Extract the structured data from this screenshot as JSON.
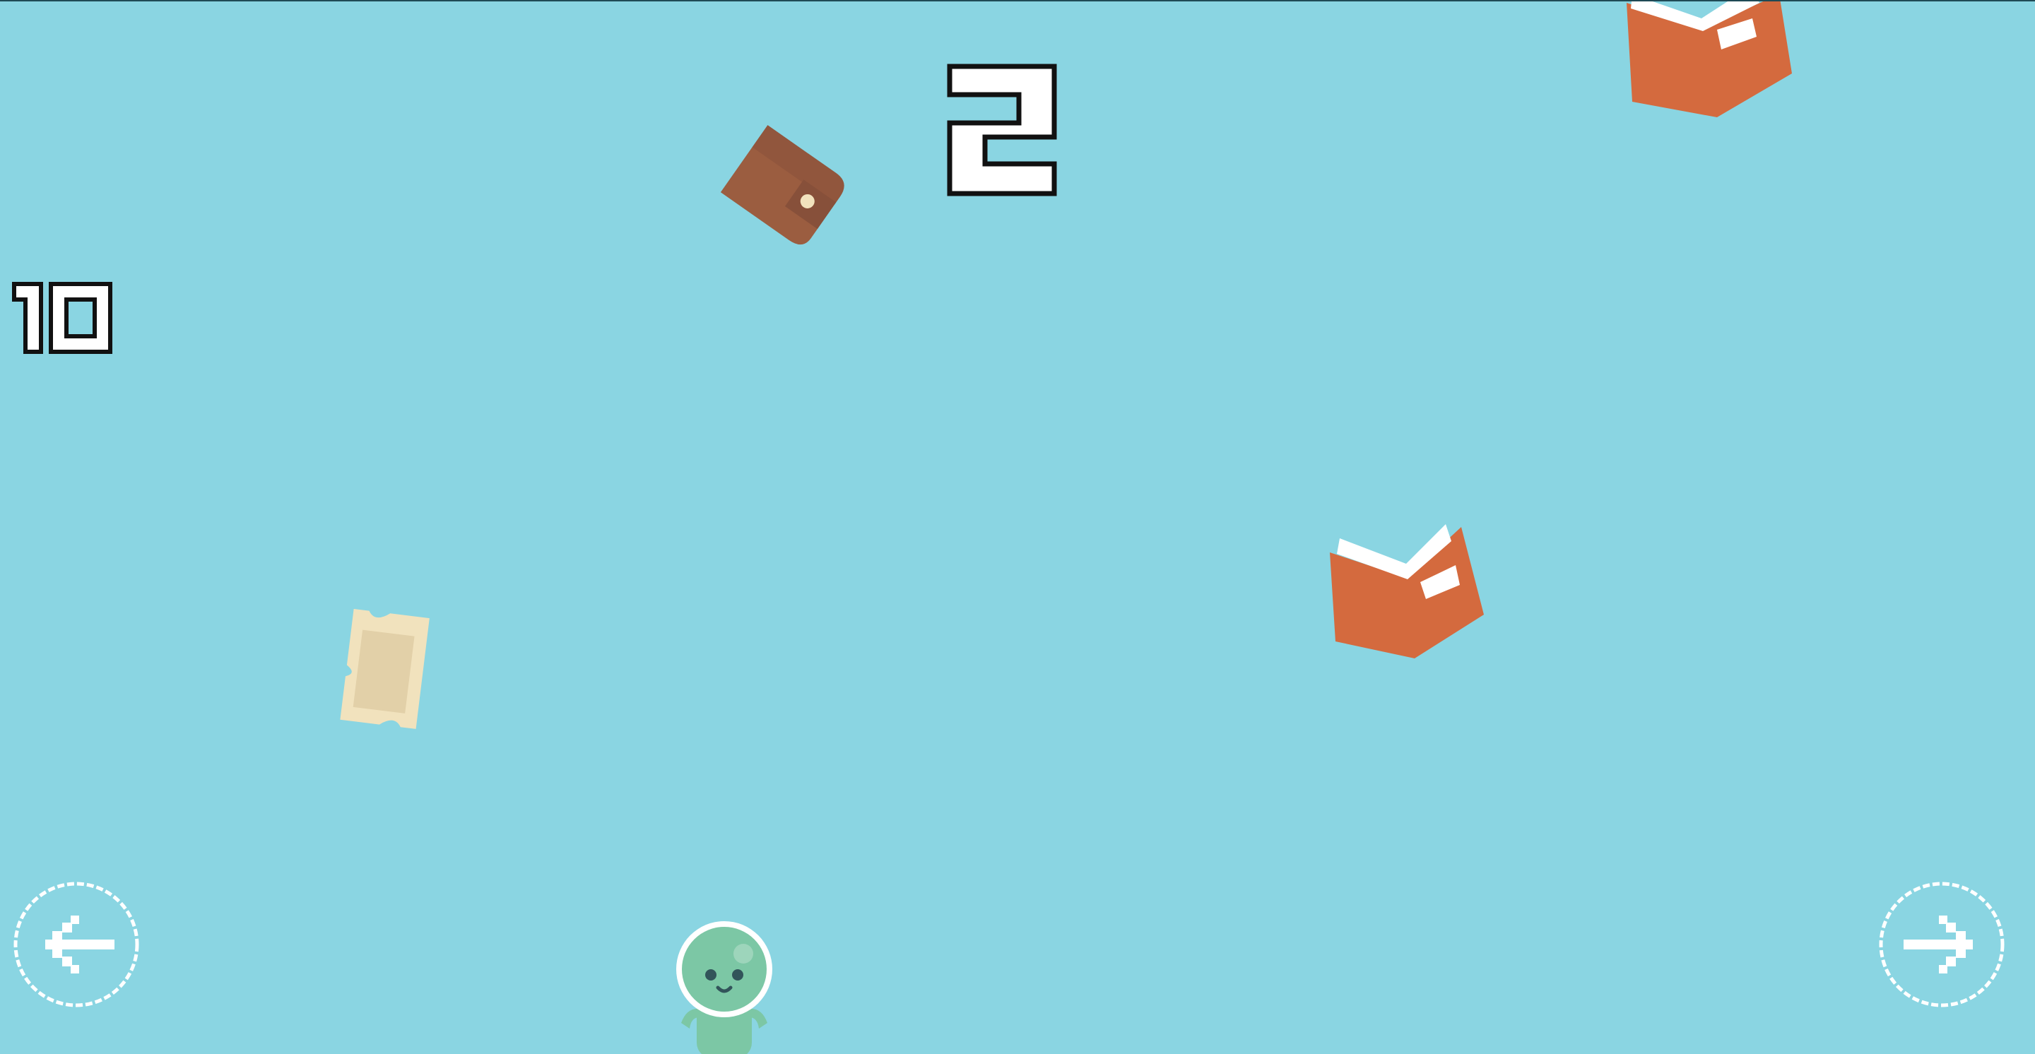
{
  "game": {
    "score": "2",
    "lives": "10"
  },
  "controls": {
    "left_icon": "arrow-left-icon",
    "right_icon": "arrow-right-icon"
  },
  "items": [
    {
      "kind": "wallet"
    },
    {
      "kind": "book"
    },
    {
      "kind": "book"
    },
    {
      "kind": "ticket"
    }
  ],
  "colors": {
    "background": "#8ad5e2",
    "book": "#d46a3e",
    "wallet": "#9b5d40",
    "ticket": "#f1e2bd",
    "player": "#7cc7a5",
    "digit_fill": "#ffffff",
    "digit_stroke": "#111111"
  }
}
